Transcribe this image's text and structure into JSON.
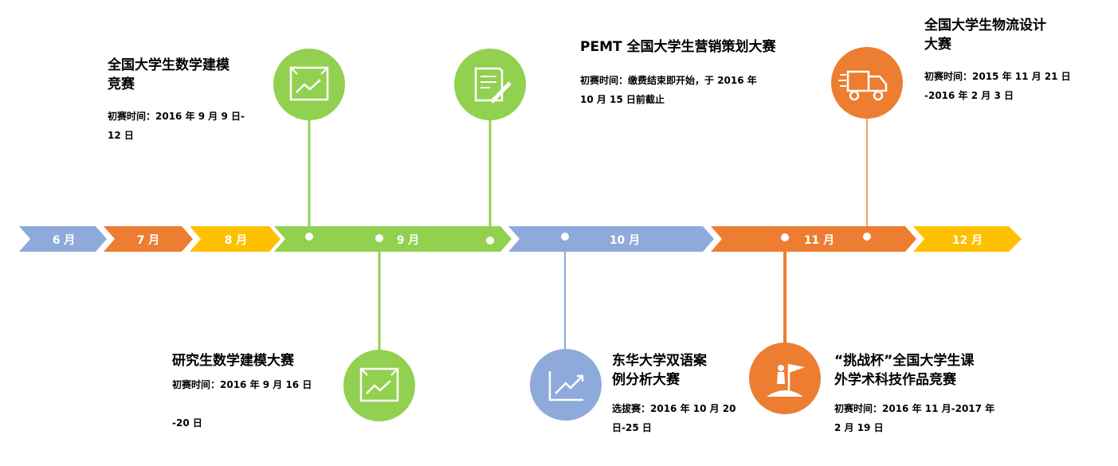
{
  "months": [
    {
      "label": "6 月",
      "color": "#8eaadb"
    },
    {
      "label": "7 月",
      "color": "#ed7d31"
    },
    {
      "label": "8 月",
      "color": "#ffc000"
    },
    {
      "label": "9 月",
      "color": "#92d050"
    },
    {
      "label": "10 月",
      "color": "#8eaadb"
    },
    {
      "label": "11 月",
      "color": "#ed7d31"
    },
    {
      "label": "12 月",
      "color": "#ffc000"
    }
  ],
  "events": [
    {
      "id": "math-modeling",
      "title": "全国大学生数学建模\n竞赛",
      "date": "初赛时间：2016 年 9 月 9 日-\n12 日",
      "icon": "chart-board-icon",
      "color": "#92d050"
    },
    {
      "id": "pemt",
      "title": "PEMT 全国大学生营销策划大赛",
      "date": "初赛时间：缴费结束即开始，于 2016 年\n10 月 15 日前截止",
      "icon": "document-pen-icon",
      "color": "#92d050"
    },
    {
      "id": "logistics",
      "title": "全国大学生物流设计\n大赛",
      "date": "初赛时间：2015 年 11 月 21 日\n-2016 年 2 月 3 日",
      "icon": "truck-icon",
      "color": "#ed7d31"
    },
    {
      "id": "grad-math",
      "title": "研究生数学建模大赛",
      "date": "初赛时间：2016 年 9 月 16 日\n\n-20 日",
      "icon": "chart-board-icon",
      "color": "#92d050"
    },
    {
      "id": "donghua",
      "title": "东华大学双语案\n例分析大赛",
      "date": "选拔赛：2016 年 10 月 20\n日-25 日",
      "icon": "trend-chart-icon",
      "color": "#8eaadb"
    },
    {
      "id": "challenge-cup",
      "title": "“挑战杯”全国大学生课\n外学术科技作品竞赛",
      "date": "初赛时间：2016 年 11 月-2017 年\n2 月 19 日",
      "icon": "flag-summit-icon",
      "color": "#ed7d31"
    }
  ]
}
